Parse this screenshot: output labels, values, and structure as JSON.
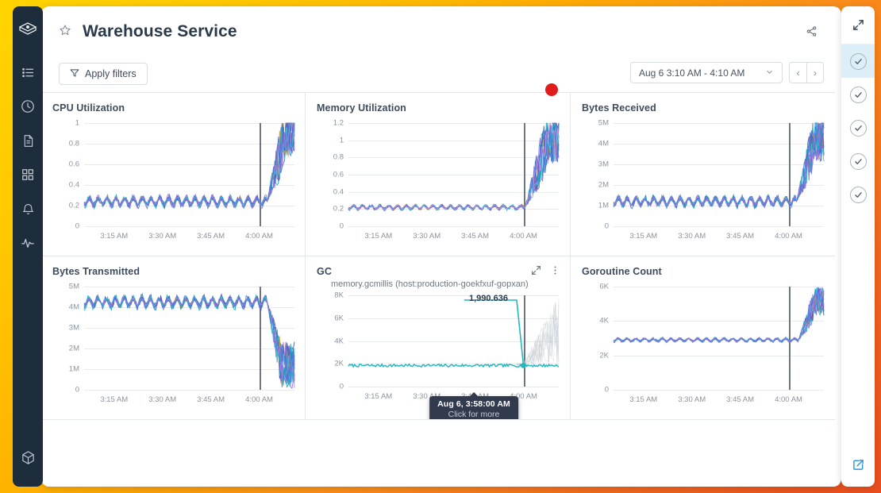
{
  "sidebar": {
    "logo_icon": "cube-logo-icon",
    "items": [
      {
        "icon": "list-icon",
        "name": "sidebar-item-list"
      },
      {
        "icon": "clock-icon",
        "name": "sidebar-item-history"
      },
      {
        "icon": "document-icon",
        "name": "sidebar-item-documents"
      },
      {
        "icon": "grid-icon",
        "name": "sidebar-item-dashboards"
      },
      {
        "icon": "bell-icon",
        "name": "sidebar-item-alerts"
      },
      {
        "icon": "pulse-icon",
        "name": "sidebar-item-monitors"
      }
    ],
    "bottom_icon": "package-icon"
  },
  "header": {
    "title": "Warehouse Service",
    "star_icon": "star-icon",
    "share_icon": "share-icon"
  },
  "toolbar": {
    "apply_filters_label": "Apply filters",
    "filter_icon": "filter-icon",
    "time_range": "Aug 6 3:10 AM - 4:10 AM",
    "chevron_icon": "chevron-down-icon",
    "prev_label": "‹",
    "next_label": "›"
  },
  "right_rail": {
    "expand_icon": "expand-diagonal-icon",
    "check_items": [
      {
        "label": "check-1",
        "active": true
      },
      {
        "label": "check-2",
        "active": false
      },
      {
        "label": "check-3",
        "active": false
      },
      {
        "label": "check-4",
        "active": false
      },
      {
        "label": "check-5",
        "active": false
      }
    ],
    "external_icon": "external-link-icon"
  },
  "tooltip": {
    "title": "Aug 6, 3:58:00 AM",
    "subtitle": "Click for more"
  },
  "colors": {
    "accent_orange": "#EA4E1E",
    "accent_yellow": "#FFD400",
    "rail_dark": "#1E2D3B",
    "cursor_red": "#E01B1B",
    "gc_series_teal": "#21B8BF",
    "tooltip_bg": "#323B4E",
    "external_blue": "#2E92E0"
  },
  "chart_data": [
    {
      "type": "line",
      "title": "CPU Utilization",
      "subtitle": "",
      "xlabel": "",
      "ylabel": "",
      "xticks": [
        "3:15 AM",
        "3:30 AM",
        "3:45 AM",
        "4:00 AM"
      ],
      "yticks": [
        "0",
        "0.2",
        "0.4",
        "0.6",
        "0.8",
        "1"
      ],
      "ylim": [
        0,
        1
      ],
      "grid": true,
      "legend": "none",
      "cursor_x_label": "4:00 AM",
      "series_count": 12,
      "baseline_value": 0.24,
      "baseline_noise": 0.05,
      "spike_peak": 0.93,
      "spike_start_fraction": 0.87,
      "series_colors": [
        "#4B6FD8",
        "#29B6C8",
        "#7B5FD1",
        "#C9A227",
        "#3F51B5",
        "#14A8B8",
        "#8E6BD6",
        "#2D7FC9",
        "#6A5ACD",
        "#31C4D2",
        "#5A78E0",
        "#9B7BD8"
      ]
    },
    {
      "type": "line",
      "title": "Memory Utilization",
      "subtitle": "",
      "xlabel": "",
      "ylabel": "",
      "xticks": [
        "3:15 AM",
        "3:30 AM",
        "3:45 AM",
        "4:00 AM"
      ],
      "yticks": [
        "0",
        "0.2",
        "0.4",
        "0.6",
        "0.8",
        "1",
        "1.2"
      ],
      "ylim": [
        0,
        1.2
      ],
      "grid": true,
      "legend": "none",
      "cursor_x_label": "4:00 AM",
      "series_count": 12,
      "baseline_value": 0.22,
      "baseline_noise": 0.03,
      "spike_peak": 1.02,
      "spike_start_fraction": 0.84,
      "series_colors": [
        "#4B6FD8",
        "#29B6C8",
        "#7B5FD1",
        "#C9A227",
        "#3F51B5",
        "#14A8B8",
        "#8E6BD6",
        "#2D7FC9",
        "#6A5ACD",
        "#31C4D2",
        "#5A78E0",
        "#DA8FD0"
      ]
    },
    {
      "type": "line",
      "title": "Bytes Received",
      "subtitle": "",
      "xlabel": "",
      "ylabel": "",
      "xticks": [
        "3:15 AM",
        "3:30 AM",
        "3:45 AM",
        "4:00 AM"
      ],
      "yticks": [
        "0",
        "1M",
        "2M",
        "3M",
        "4M",
        "5M"
      ],
      "ylim": [
        0,
        5000000
      ],
      "grid": true,
      "legend": "none",
      "cursor_x_label": "4:00 AM",
      "series_count": 12,
      "baseline_value": 1200000,
      "baseline_noise": 250000,
      "spike_peak": 4300000,
      "spike_start_fraction": 0.87,
      "series_colors": [
        "#4B6FD8",
        "#29B6C8",
        "#7B5FD1",
        "#C9A227",
        "#3F51B5",
        "#14A8B8",
        "#8E6BD6",
        "#2D7FC9",
        "#6A5ACD",
        "#31C4D2",
        "#5A78E0",
        "#9B7BD8"
      ]
    },
    {
      "type": "line",
      "title": "Bytes Transmitted",
      "subtitle": "",
      "xlabel": "",
      "ylabel": "",
      "xticks": [
        "3:15 AM",
        "3:30 AM",
        "3:45 AM",
        "4:00 AM"
      ],
      "yticks": [
        "0",
        "1M",
        "2M",
        "3M",
        "4M",
        "5M"
      ],
      "ylim": [
        0,
        5000000
      ],
      "grid": true,
      "legend": "none",
      "cursor_x_label": "4:00 AM",
      "series_count": 12,
      "baseline_value": 4250000,
      "baseline_noise": 300000,
      "spike_peak": 1200000,
      "spike_direction": "down",
      "spike_start_fraction": 0.87,
      "series_colors": [
        "#4B6FD8",
        "#29B6C8",
        "#7B5FD1",
        "#C9A227",
        "#3F51B5",
        "#14A8B8",
        "#8E6BD6",
        "#2D7FC9",
        "#6A5ACD",
        "#31C4D2",
        "#5A78E0",
        "#9B7BD8"
      ]
    },
    {
      "type": "line",
      "title": "GC",
      "subtitle": "memory.gcmillis (host:production-goekfxuf-gopxan)",
      "xlabel": "",
      "ylabel": "",
      "xticks": [
        "3:15 AM",
        "3:30 AM",
        "3:45 AM",
        "4:00 AM"
      ],
      "yticks": [
        "0",
        "2K",
        "4K",
        "6K",
        "8K"
      ],
      "ylim": [
        0,
        8000
      ],
      "grid": true,
      "legend": "none",
      "cursor_x_label": "4:00 AM",
      "value_label": "1,990.636",
      "highlight_color": "#21B8BF",
      "series_count": 1,
      "baseline_value": 1850,
      "baseline_noise": 120,
      "expand_icon": "expand-diagonal-icon",
      "menu_icon": "more-vertical-icon"
    },
    {
      "type": "line",
      "title": "Goroutine Count",
      "subtitle": "",
      "xlabel": "",
      "ylabel": "",
      "xticks": [
        "3:15 AM",
        "3:30 AM",
        "3:45 AM",
        "4:00 AM"
      ],
      "yticks": [
        "0",
        "2K",
        "4K",
        "6K"
      ],
      "ylim": [
        0,
        6000
      ],
      "grid": true,
      "legend": "none",
      "cursor_x_label": "4:00 AM",
      "series_count": 12,
      "baseline_value": 2900,
      "baseline_noise": 120,
      "spike_peak": 5150,
      "spike_start_fraction": 0.88,
      "series_colors": [
        "#4B6FD8",
        "#29B6C8",
        "#7B5FD1",
        "#C9A227",
        "#3F51B5",
        "#14A8B8",
        "#8E6BD6",
        "#2D7FC9",
        "#6A5ACD",
        "#31C4D2",
        "#5A78E0",
        "#9B7BD8"
      ]
    }
  ]
}
